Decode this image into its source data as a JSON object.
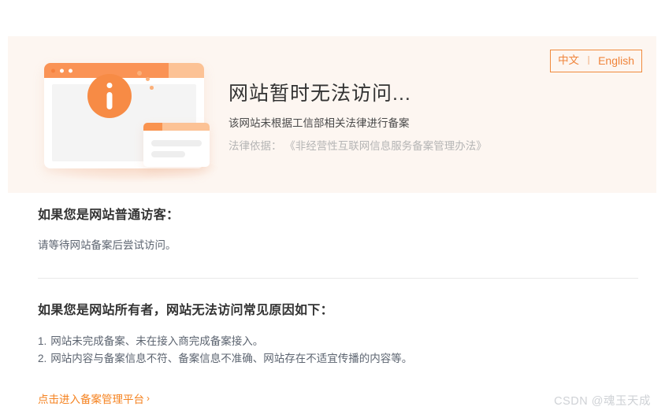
{
  "banner": {
    "language_switch": {
      "chinese_label": "中文",
      "separator": "丨",
      "english_label": "English"
    },
    "title": "网站暂时无法访问...",
    "subtitle": "该网站未根据工信部相关法律进行备案",
    "legal_basis": "法律依据： 《非经营性互联网信息服务备案管理办法》",
    "illustration": {
      "info_icon_name": "info-circle-icon",
      "background_color": "#fdf6f1",
      "accent_color": "#f78b45"
    }
  },
  "visitor_section": {
    "heading": "如果您是网站普通访客：",
    "body": "请等待网站备案后尝试访问。"
  },
  "owner_section": {
    "heading": "如果您是网站所有者，网站无法访问常见原因如下：",
    "reasons": [
      {
        "number": "1.",
        "text": "网站未完成备案、未在接入商完成备案接入。"
      },
      {
        "number": "2.",
        "text": "网站内容与备案信息不符、备案信息不准确、网站存在不适宜传播的内容等。"
      }
    ]
  },
  "footer": {
    "link_label": "点击进入备案管理平台",
    "link_chevron": "›",
    "link_color": "#f5821f"
  },
  "watermark": {
    "text": "CSDN @魂玉天成"
  }
}
